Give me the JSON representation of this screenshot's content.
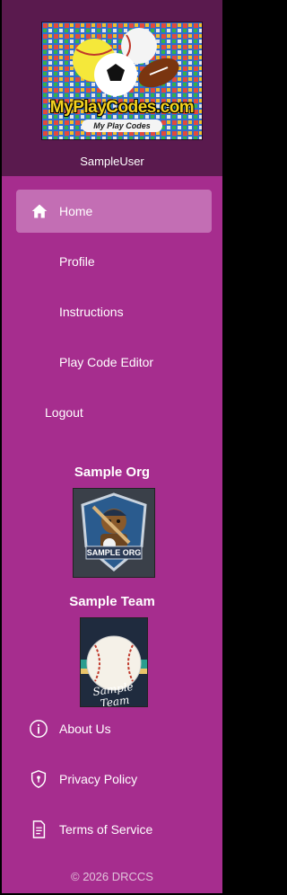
{
  "header": {
    "logo_text": "MyPlayCodes.com",
    "logo_subtext": "My Play Codes",
    "username": "SampleUser"
  },
  "nav": {
    "items": [
      {
        "label": "Home",
        "active": true,
        "icon": "home-icon"
      },
      {
        "label": "Profile",
        "active": false
      },
      {
        "label": "Instructions",
        "active": false
      },
      {
        "label": "Play Code Editor",
        "active": false
      }
    ],
    "logout_label": "Logout"
  },
  "org": {
    "title": "Sample Org",
    "badge_text": "SAMPLE ORG"
  },
  "team": {
    "title": "Sample Team",
    "badge_text": "Sample Team"
  },
  "footer": {
    "links": [
      {
        "label": "About Us",
        "icon": "info-icon"
      },
      {
        "label": "Privacy Policy",
        "icon": "shield-icon"
      },
      {
        "label": "Terms of Service",
        "icon": "document-icon"
      }
    ],
    "copyright": "© 2026 DRCCS"
  },
  "colors": {
    "sidebar_bg": "#a62d8e",
    "header_bg": "#5a1a4e",
    "active_item_bg": "#c36eb4"
  }
}
